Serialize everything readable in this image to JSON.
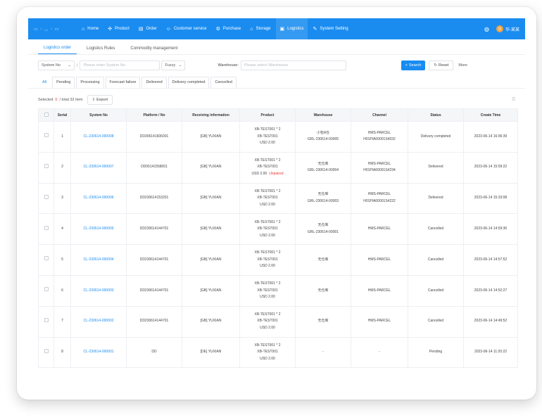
{
  "nav": {
    "items": [
      {
        "label": "Home",
        "icon": "home-icon",
        "glyph": "⌂"
      },
      {
        "label": "Product",
        "icon": "product-icon",
        "glyph": "✣"
      },
      {
        "label": "Order",
        "icon": "order-icon",
        "glyph": "▤"
      },
      {
        "label": "Customer service",
        "icon": "customer-icon",
        "glyph": "☺"
      },
      {
        "label": "Purchase",
        "icon": "purchase-icon",
        "glyph": "⚙"
      },
      {
        "label": "Storage",
        "icon": "storage-icon",
        "glyph": "⌂"
      },
      {
        "label": "Logistics",
        "icon": "logistics-icon",
        "glyph": "▣"
      },
      {
        "label": "System Setting",
        "icon": "setting-icon",
        "glyph": "✎"
      }
    ],
    "user": "华-某某",
    "avatar": "华"
  },
  "subtabs": [
    "Logistics order",
    "Logistics Rules",
    "Commodity management"
  ],
  "filters": {
    "field_select": "System No",
    "search_placeholder": "Please enter System No.",
    "match_select": "Fuzzy",
    "warehouse_label": "Warehouse:",
    "warehouse_placeholder": "Please select Warehouse",
    "search_btn": "Search",
    "reset_btn": "Reset",
    "more": "More"
  },
  "status_tabs": [
    "All",
    "Pending",
    "Processing",
    "Forecast failure",
    "Delivered",
    "Delivery completed",
    "Cancelled"
  ],
  "toolbar": {
    "selected_label": "Selected",
    "selected_count": "0",
    "total_text": "/ total 32 item",
    "export": "Export"
  },
  "table": {
    "headers": [
      "Serial",
      "System No",
      "Platform / No",
      "Receiving information",
      "Product",
      "Warehouse",
      "Channel",
      "Status",
      "Create Time"
    ],
    "rows": [
      {
        "serial": "1",
        "system_no": "CL-230614-000008",
        "platform": "DD306141606001",
        "receiving": "[GB] YUXIAN",
        "product": [
          "XB-TEST001 * 2",
          "XB-TEST001",
          "USD 2.00"
        ],
        "unpaired": "",
        "warehouse": [
          "小包A仓",
          "GRL-230614-00005"
        ],
        "channel": [
          "HMS-PARCEL",
          "H01PIA00001S4032"
        ],
        "status": "Delivery completed",
        "time": "2023-06-14 16:06:39"
      },
      {
        "serial": "2",
        "system_no": "CL-230614-000007",
        "platform": "DD05141558001",
        "receiving": "[GB] YUXIAN",
        "product": [
          "XB-TEST001 * 2",
          "XB-TEST001",
          "USD 2.00"
        ],
        "unpaired": "Unpaired",
        "warehouse": [
          "无仓库",
          "GRL-230614-00004"
        ],
        "channel": [
          "HMS-PARCEL",
          "H01PIA00001S4234"
        ],
        "status": "Delivered",
        "time": "2023-06-14 15:59:22"
      },
      {
        "serial": "3",
        "system_no": "CL-230614-000006",
        "platform": "DD230614153201",
        "receiving": "[GB] YUXIAN",
        "product": [
          "XB-TEST001 * 2",
          "XB-TEST001",
          "USD 2.00"
        ],
        "unpaired": "",
        "warehouse": [
          "无仓库",
          "GRL-230614-00003"
        ],
        "channel": [
          "HMS-PARCEL",
          "H01PIA00001S4222"
        ],
        "status": "Delivered",
        "time": "2023-06-14 15:33:08"
      },
      {
        "serial": "4",
        "system_no": "CL-230614-000005",
        "platform": "DD230614144701",
        "receiving": "[GB] YUXIAN",
        "product": [
          "XB-TEST001 * 2",
          "XB-TEST001",
          "USD 2.00"
        ],
        "unpaired": "",
        "warehouse": [
          "无仓库",
          "GRL-230614-00001"
        ],
        "channel": [
          "HMS-PARCEL"
        ],
        "status": "Cancelled",
        "time": "2023-06-14 14:59:36"
      },
      {
        "serial": "5",
        "system_no": "CL-230614-000004",
        "platform": "DD230614144701",
        "receiving": "[GB] YUXIAN",
        "product": [
          "XB-TEST001 * 2",
          "XB-TEST001",
          "USD 2.00"
        ],
        "unpaired": "",
        "warehouse": [
          "无仓库"
        ],
        "channel": [
          "HMS-PARCEL"
        ],
        "status": "Cancelled",
        "time": "2023-06-14 14:57:52"
      },
      {
        "serial": "6",
        "system_no": "CL-230614-000003",
        "platform": "DD230614144701",
        "receiving": "[GB] YUXIAN",
        "product": [
          "XB-TEST001 * 2",
          "XB-TEST001",
          "USD 2.00"
        ],
        "unpaired": "",
        "warehouse": [
          "无仓库"
        ],
        "channel": [
          "HMS-PARCEL"
        ],
        "status": "Cancelled",
        "time": "2023-06-14 14:52:27"
      },
      {
        "serial": "7",
        "system_no": "CL-230614-000002",
        "platform": "DD230614144701",
        "receiving": "[GB] YUXIAN",
        "product": [
          "XB-TEST001 * 2",
          "XB-TEST001",
          "USD 2.00"
        ],
        "unpaired": "",
        "warehouse": [
          "无仓库"
        ],
        "channel": [
          "HMS-PARCEL"
        ],
        "status": "Cancelled",
        "time": "2023-06-14 14:49:52"
      },
      {
        "serial": "8",
        "system_no": "CL-230614-000001",
        "platform": "DD",
        "receiving": "[DE] YUXIAN",
        "product": [
          "XB-TEST001 * 2",
          "XB-TEST001",
          "USD 2.00"
        ],
        "unpaired": "",
        "warehouse": [
          "-"
        ],
        "channel": [
          "-"
        ],
        "status": "Pending",
        "time": "2023-06-14 11:20:22"
      }
    ]
  },
  "colors": {
    "primary": "#1a8cf0",
    "danger": "#e53935"
  }
}
